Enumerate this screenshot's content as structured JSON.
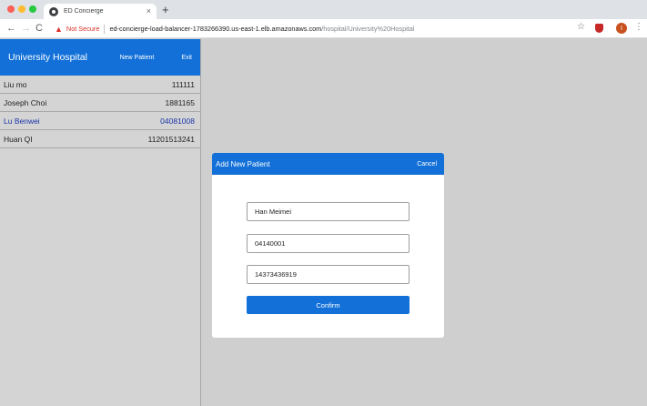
{
  "browser": {
    "tab_title": "ED Concierge",
    "tab_close": "×",
    "new_tab": "+",
    "not_secure": "Not Secure",
    "url_host": "ed-concierge-load-balancer-1783266390.us-east-1.elb.amazonaws.com",
    "url_path": "/hospital/University%20Hospital",
    "profile_initial": "I"
  },
  "sidebar": {
    "title": "University Hospital",
    "new_patient_label": "New Patient",
    "exit_label": "Exit",
    "patients": [
      {
        "name": "Liu mo",
        "id": "111111"
      },
      {
        "name": "Joseph Choi",
        "id": "1881165"
      },
      {
        "name": "Lu Benwei",
        "id": "04081008"
      },
      {
        "name": "Huan QI",
        "id": "11201513241"
      }
    ]
  },
  "modal": {
    "title": "Add New Patient",
    "cancel_label": "Cancel",
    "name_value": "Han Meimei",
    "id_value": "04140001",
    "phone_value": "14373436919",
    "confirm_label": "Confirm"
  },
  "colors": {
    "accent": "#1270d8",
    "patient_link": "#1a35a8",
    "warning": "#d93025"
  }
}
